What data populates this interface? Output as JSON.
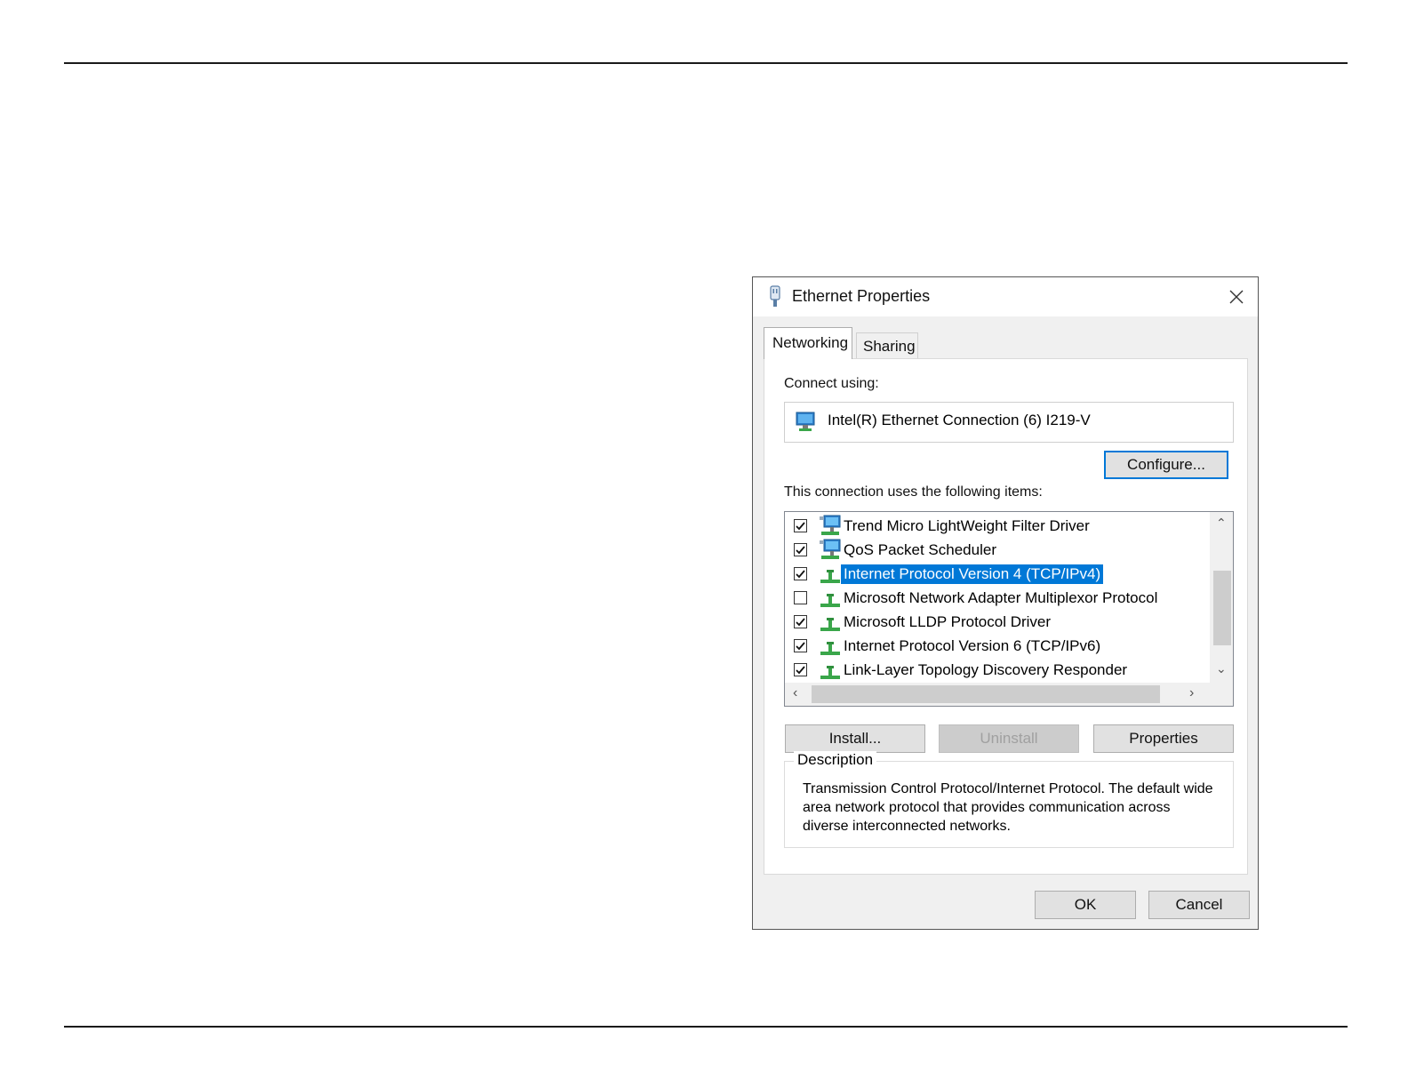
{
  "dialog": {
    "title": "Ethernet Properties",
    "title_icon": "ethernet-adapter-icon",
    "close_icon": "close-icon"
  },
  "tabs": [
    {
      "label": "Networking",
      "active": true
    },
    {
      "label": "Sharing",
      "active": false
    }
  ],
  "connect_using": {
    "label": "Connect using:",
    "adapter": "Intel(R) Ethernet Connection (6) I219-V",
    "adapter_icon": "network-adapter-icon",
    "configure_label": "Configure..."
  },
  "items_section": {
    "label": "This connection uses the following items:",
    "items": [
      {
        "label": "Trend Micro LightWeight Filter Driver",
        "checked": true,
        "icon": "network-service-icon",
        "selected": false
      },
      {
        "label": "QoS Packet Scheduler",
        "checked": true,
        "icon": "network-service-icon",
        "selected": false
      },
      {
        "label": "Internet Protocol Version 4 (TCP/IPv4)",
        "checked": true,
        "icon": "network-protocol-icon",
        "selected": true
      },
      {
        "label": "Microsoft Network Adapter Multiplexor Protocol",
        "checked": false,
        "icon": "network-protocol-icon",
        "selected": false
      },
      {
        "label": "Microsoft LLDP Protocol Driver",
        "checked": true,
        "icon": "network-protocol-icon",
        "selected": false
      },
      {
        "label": "Internet Protocol Version 6 (TCP/IPv6)",
        "checked": true,
        "icon": "network-protocol-icon",
        "selected": false
      },
      {
        "label": "Link-Layer Topology Discovery Responder",
        "checked": true,
        "icon": "network-protocol-icon",
        "selected": false
      }
    ]
  },
  "buttons": {
    "install": "Install...",
    "uninstall": "Uninstall",
    "properties": "Properties",
    "ok": "OK",
    "cancel": "Cancel"
  },
  "description": {
    "title": "Description",
    "text": "Transmission Control Protocol/Internet Protocol. The default wide area network protocol that provides communication across diverse interconnected networks."
  },
  "colors": {
    "selection": "#0078d7",
    "focus_border": "#0078d7",
    "protocol_green": "#3aa64a"
  }
}
